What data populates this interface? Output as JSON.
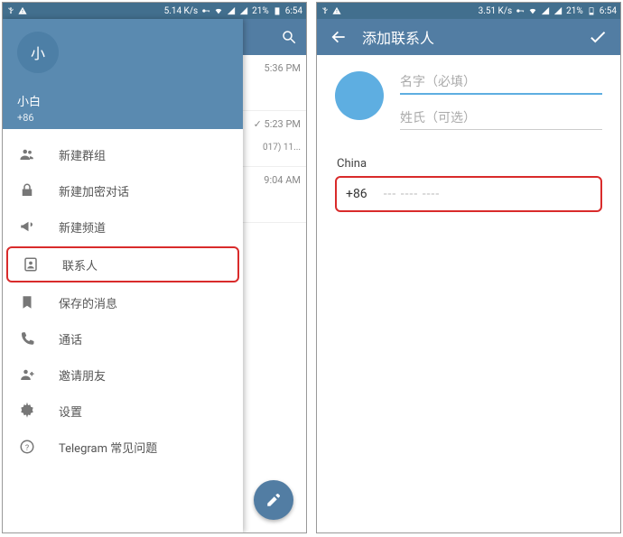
{
  "leftPhone": {
    "statusbar": {
      "speed": "5.14 K/s",
      "battery": "21%",
      "time": "6:54"
    },
    "drawer": {
      "avatar_initial": "小",
      "username": "小白",
      "phone": "+86",
      "items": [
        {
          "label": "新建群组",
          "icon": "group"
        },
        {
          "label": "新建加密对话",
          "icon": "lock"
        },
        {
          "label": "新建频道",
          "icon": "megaphone"
        },
        {
          "label": "联系人",
          "icon": "contact",
          "highlight": true
        },
        {
          "label": "保存的消息",
          "icon": "bookmark"
        },
        {
          "label": "通话",
          "icon": "phone"
        },
        {
          "label": "邀请朋友",
          "icon": "invite"
        },
        {
          "label": "设置",
          "icon": "gear"
        },
        {
          "label": "Telegram 常见问题",
          "icon": "help"
        }
      ]
    },
    "chat_peek": [
      {
        "time": "5:36 PM",
        "meta": ""
      },
      {
        "time": "5:23 PM",
        "meta": "017) 11..."
      },
      {
        "time": "9:04 AM",
        "meta": ""
      }
    ],
    "fab_icon": "pencil"
  },
  "rightPhone": {
    "statusbar": {
      "speed": "3.51 K/s",
      "battery": "21%",
      "time": "6:54"
    },
    "header": {
      "title": "添加联系人"
    },
    "name_placeholder": "名字（必填）",
    "surname_placeholder": "姓氏（可选）",
    "country_label": "China",
    "country_code": "+86",
    "phone_mask": "--- ---- ----"
  }
}
